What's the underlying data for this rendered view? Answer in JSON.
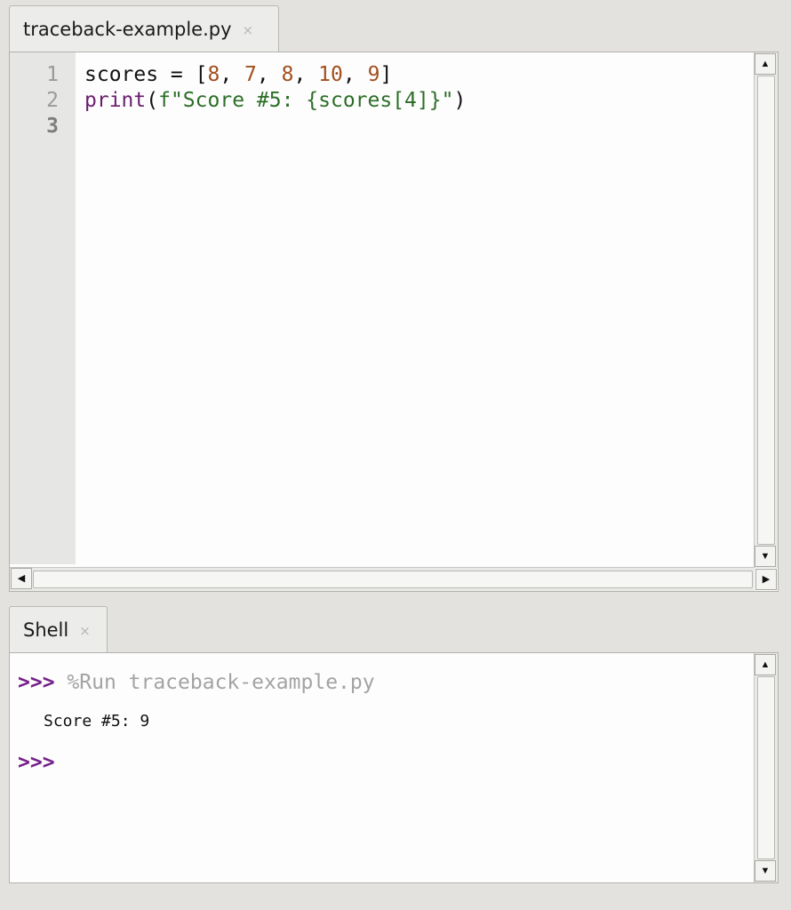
{
  "editor": {
    "tab": {
      "title": "traceback-example.py",
      "close_glyph": "×"
    },
    "line_numbers": [
      "1",
      "2",
      "3"
    ],
    "code": {
      "line1": {
        "prefix": "scores = [",
        "n1": "8",
        "sep1": ", ",
        "n2": "7",
        "sep2": ", ",
        "n3": "8",
        "sep3": ", ",
        "n4": "10",
        "sep4": ", ",
        "n5": "9",
        "suffix": "]"
      },
      "line2": {
        "fn": "print",
        "open": "(",
        "str": "f\"Score #5: {scores[4]}\"",
        "close": ")"
      }
    }
  },
  "shell": {
    "tab": {
      "title": "Shell",
      "close_glyph": "×"
    },
    "prompt": ">>>",
    "command": "%Run traceback-example.py",
    "output": "Score #5: 9"
  },
  "scrollbar": {
    "up_glyph": "▲",
    "down_glyph": "▼",
    "left_glyph": "◀",
    "right_glyph": "▶"
  },
  "colors": {
    "number": "#a1501e",
    "builtin": "#6b1d6e",
    "string": "#2c6e27",
    "prompt": "#741e8a",
    "command": "#a3a3a3"
  }
}
